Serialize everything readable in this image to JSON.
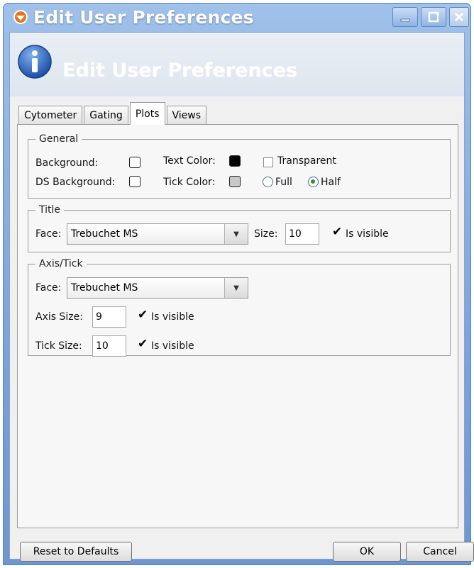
{
  "window": {
    "title": "Edit User Preferences",
    "header_title": "Edit User Preferences"
  },
  "tabs": [
    {
      "label": "Cytometer"
    },
    {
      "label": "Gating"
    },
    {
      "label": "Plots"
    },
    {
      "label": "Views"
    }
  ],
  "general": {
    "legend": "General",
    "background_label": "Background:",
    "ds_background_label": "DS Background:",
    "text_color_label": "Text Color:",
    "tick_color_label": "Tick Color:",
    "background_color": "#ffffff",
    "ds_background_color": "#ffffff",
    "text_color": "#000000",
    "tick_color": "#c8c8c8",
    "transparent_label": "Transparent",
    "transparent_checked": false,
    "full_label": "Full",
    "half_label": "Half",
    "selected_mode": "Half"
  },
  "title_group": {
    "legend": "Title",
    "face_label": "Face:",
    "face_value": "Trebuchet MS",
    "size_label": "Size:",
    "size_value": "10",
    "visible_label": "Is visible",
    "visible_checked": true
  },
  "axis_group": {
    "legend": "Axis/Tick",
    "face_label": "Face:",
    "face_value": "Trebuchet MS",
    "axis_size_label": "Axis Size:",
    "axis_size_value": "9",
    "axis_visible_label": "Is visible",
    "tick_size_label": "Tick Size:",
    "tick_size_value": "10",
    "tick_visible_label": "Is visible"
  },
  "footer": {
    "reset_label": "Reset to Defaults",
    "ok_label": "OK",
    "cancel_label": "Cancel"
  },
  "colors": {
    "titlebar": "#7ba4da",
    "radio_selected": "#3c8c3c"
  }
}
